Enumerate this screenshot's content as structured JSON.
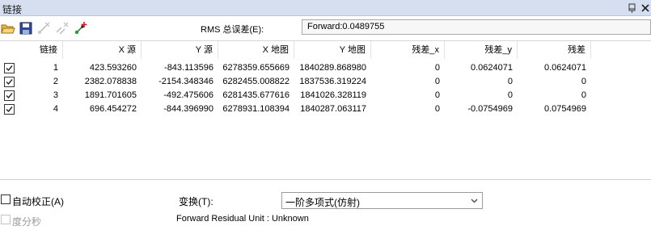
{
  "window": {
    "title": "链接"
  },
  "toolbar": {
    "rms_label": "RMS 总误差(E):",
    "rms_value": "Forward:0.0489755"
  },
  "table": {
    "headers": [
      "链接",
      "X 源",
      "Y 源",
      "X 地图",
      "Y 地图",
      "残差_x",
      "残差_y",
      "残差"
    ],
    "rows": [
      {
        "checked": true,
        "link": "1",
        "x_src": "423.593260",
        "y_src": "-843.113596",
        "x_map": "6278359.655669",
        "y_map": "1840289.868980",
        "res_x": "0",
        "res_y": "0.0624071",
        "res": "0.0624071"
      },
      {
        "checked": true,
        "link": "2",
        "x_src": "2382.078838",
        "y_src": "-2154.348346",
        "x_map": "6282455.008822",
        "y_map": "1837536.319224",
        "res_x": "0",
        "res_y": "0",
        "res": "0"
      },
      {
        "checked": true,
        "link": "3",
        "x_src": "1891.701605",
        "y_src": "-492.475606",
        "x_map": "6281435.677616",
        "y_map": "1841026.328119",
        "res_x": "0",
        "res_y": "0",
        "res": "0"
      },
      {
        "checked": true,
        "link": "4",
        "x_src": "696.454272",
        "y_src": "-844.396990",
        "x_map": "6278931.108394",
        "y_map": "1840287.063117",
        "res_x": "0",
        "res_y": "-0.0754969",
        "res": "0.0754969"
      }
    ]
  },
  "bottom": {
    "auto_adjust_label": "自动校正(A)",
    "auto_adjust_checked": false,
    "dms_label": "度分秒",
    "dms_checked": false,
    "dms_enabled": false,
    "transform_label": "变换(T):",
    "transform_value": "一阶多项式(仿射)",
    "unit_text": "Forward Residual Unit : Unknown"
  },
  "icons": [
    "open-folder-icon",
    "save-icon",
    "delete-link-icon",
    "delete-all-links-icon",
    "add-link-icon",
    "pin-icon",
    "close-icon",
    "chevron-down-icon"
  ]
}
